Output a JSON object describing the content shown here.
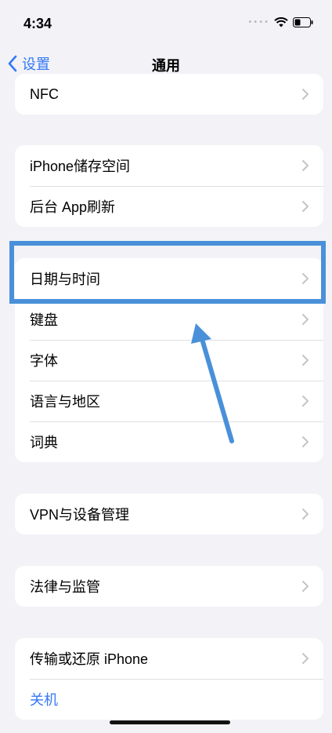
{
  "status_bar": {
    "time": "4:34"
  },
  "nav": {
    "back_label": "设置",
    "title": "通用"
  },
  "groups": [
    {
      "rows": [
        {
          "label": "NFC",
          "chevron": true
        }
      ]
    },
    {
      "rows": [
        {
          "label": "iPhone储存空间",
          "chevron": true
        },
        {
          "label": "后台 App刷新",
          "chevron": true
        }
      ]
    },
    {
      "rows": [
        {
          "label": "日期与时间",
          "chevron": true
        },
        {
          "label": "键盘",
          "chevron": true
        },
        {
          "label": "字体",
          "chevron": true
        },
        {
          "label": "语言与地区",
          "chevron": true
        },
        {
          "label": "词典",
          "chevron": true
        }
      ]
    },
    {
      "rows": [
        {
          "label": "VPN与设备管理",
          "chevron": true
        }
      ]
    },
    {
      "rows": [
        {
          "label": "法律与监管",
          "chevron": true
        }
      ]
    },
    {
      "rows": [
        {
          "label": "传输或还原 iPhone",
          "chevron": true
        },
        {
          "label": "关机",
          "chevron": false
        }
      ]
    }
  ],
  "colors": {
    "accent": "#3478f6",
    "annotation": "#4a90d9",
    "background": "#f2f2f7"
  }
}
